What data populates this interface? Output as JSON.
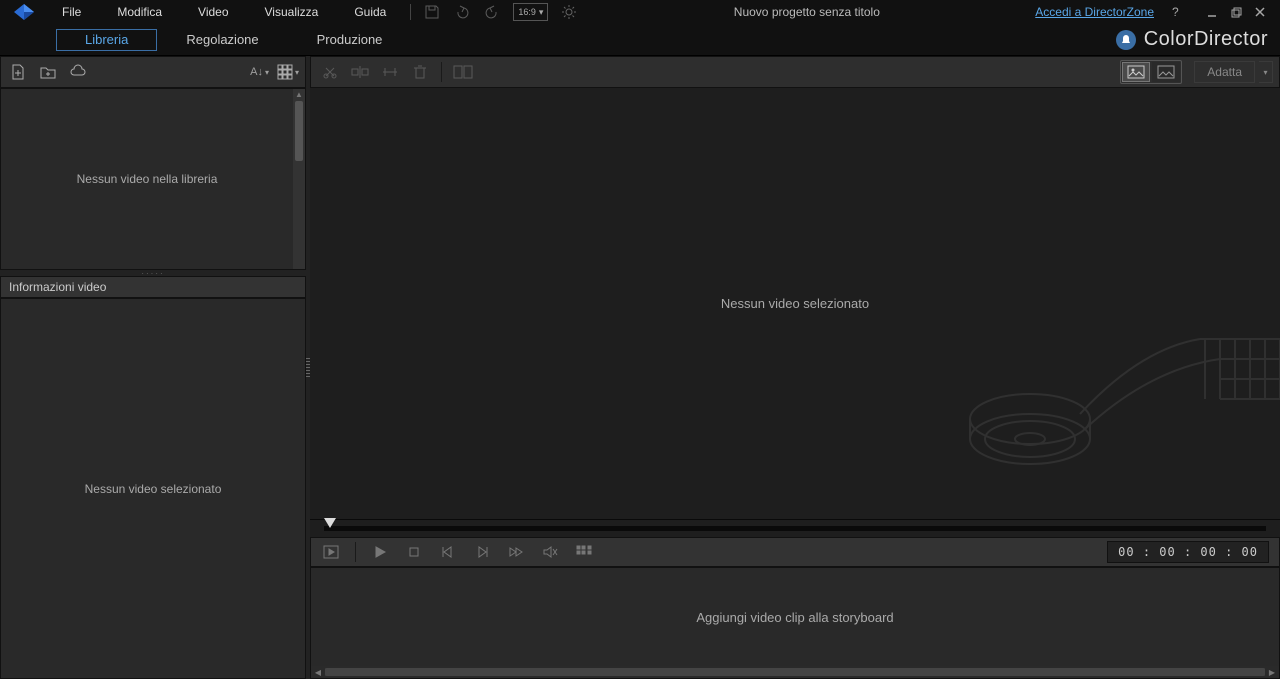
{
  "menu": {
    "file": "File",
    "edit": "Modifica",
    "video": "Video",
    "view": "Visualizza",
    "help": "Guida"
  },
  "aspect": "16:9",
  "project_title": "Nuovo progetto senza titolo",
  "dz_link": "Accedi a DirectorZone",
  "tabs": {
    "library": "Libreria",
    "adjust": "Regolazione",
    "produce": "Produzione"
  },
  "brand": "ColorDirector",
  "library_tools": {
    "sort": "A↓"
  },
  "library_empty": "Nessun video nella libreria",
  "info_header": "Informazioni video",
  "info_empty": "Nessun video selezionato",
  "preview_empty": "Nessun video selezionato",
  "fit_label": "Adatta",
  "timecode": "00 : 00 : 00 : 00",
  "storyboard_hint": "Aggiungi video clip alla storyboard"
}
